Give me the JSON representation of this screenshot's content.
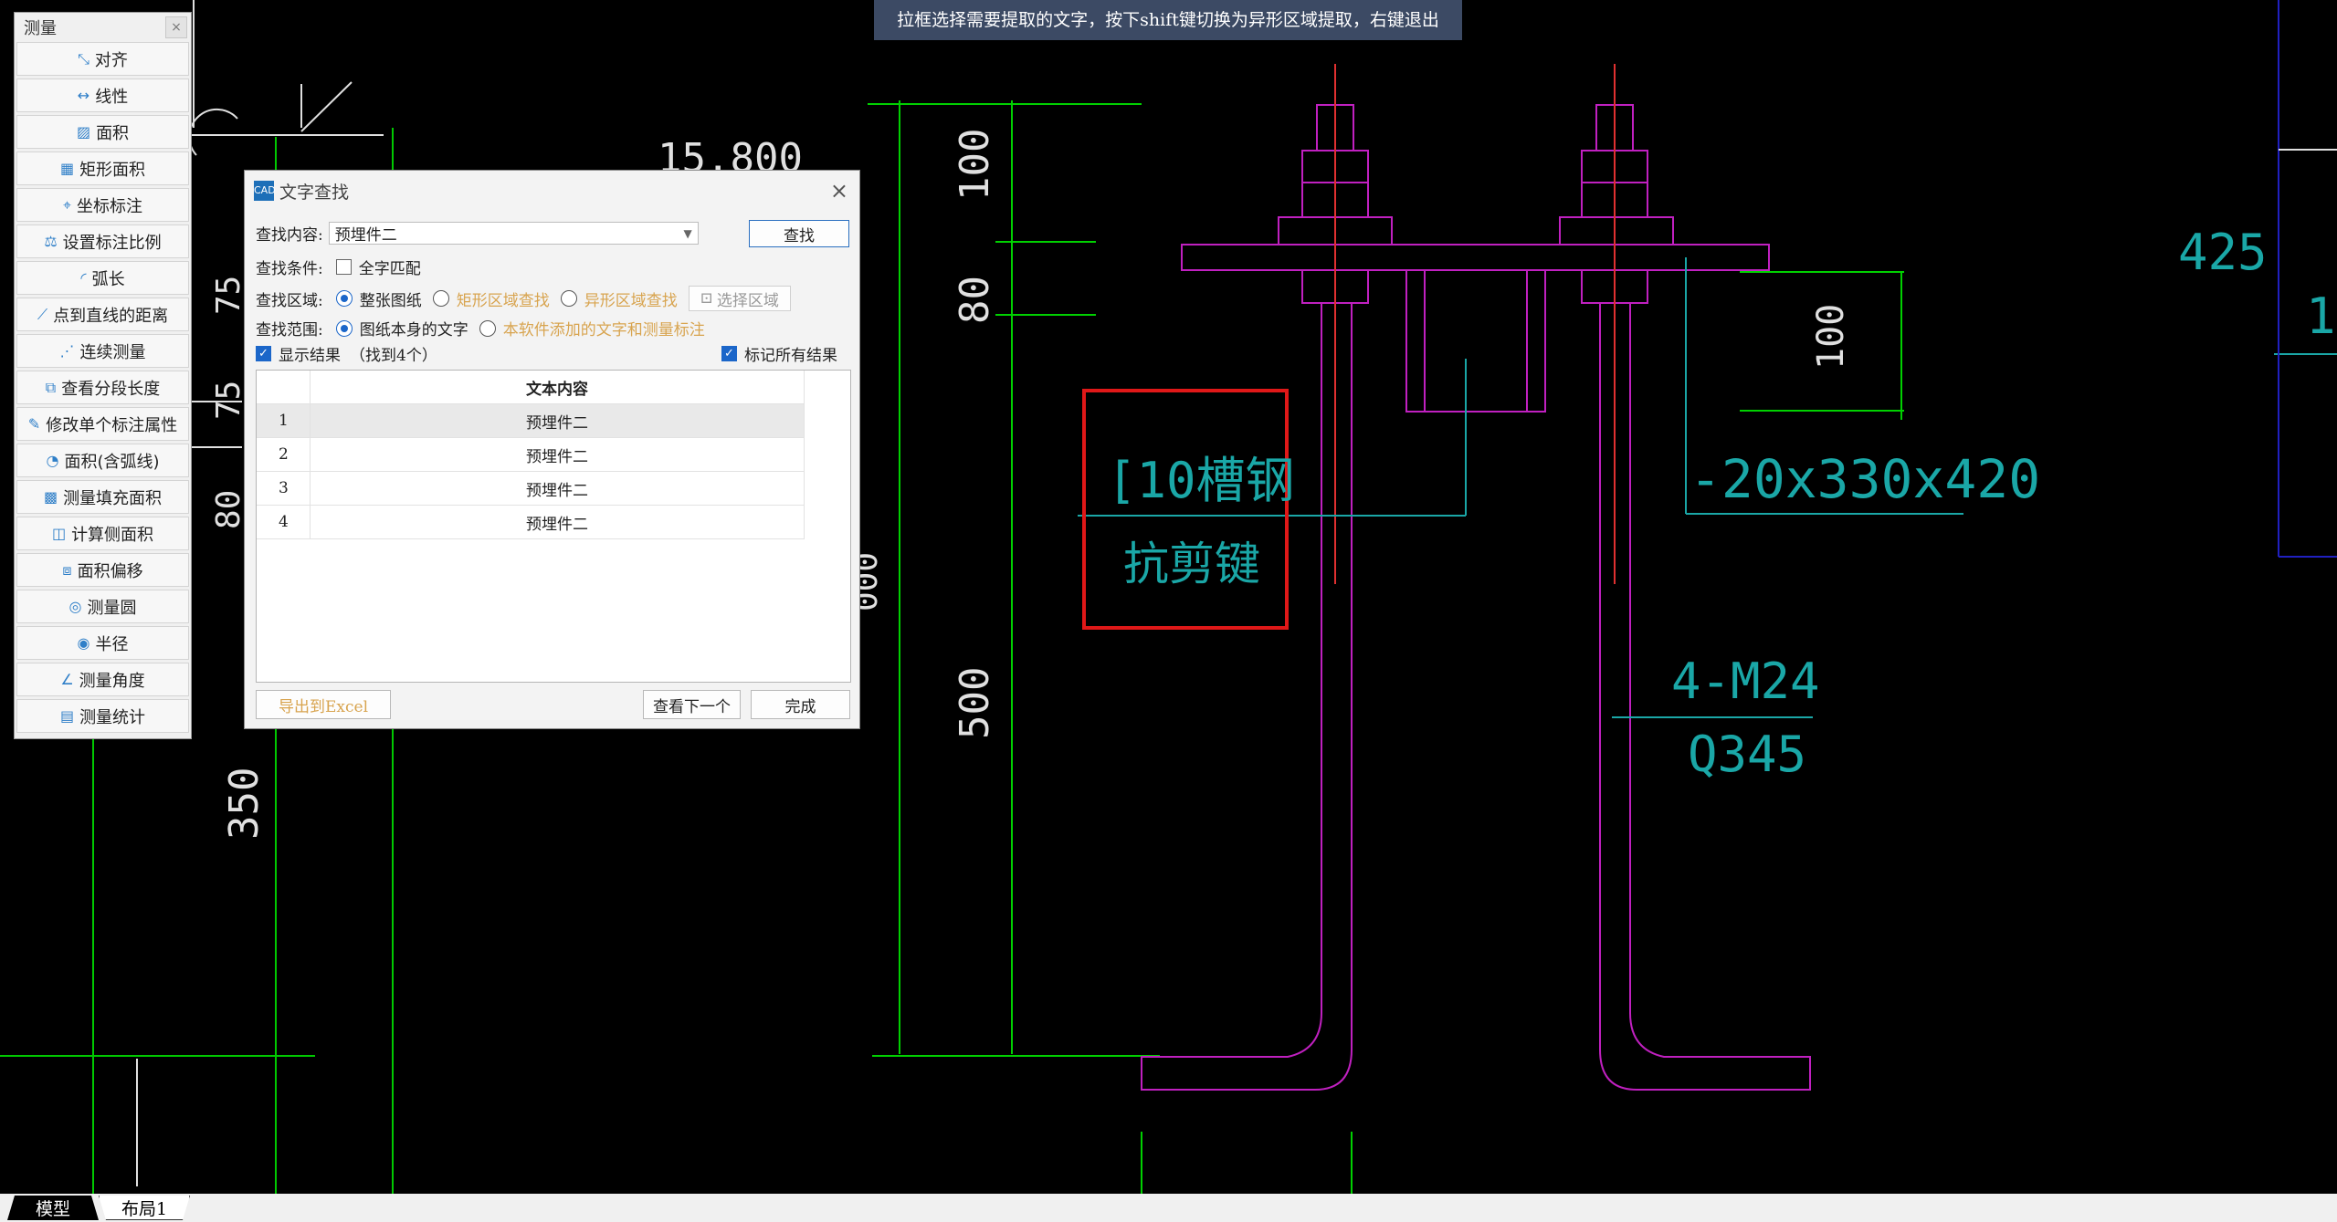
{
  "hint": "拉框选择需要提取的文字，按下shift键切换为异形区域提取，右键退出",
  "palette": {
    "title": "测量",
    "close": "×",
    "items": [
      {
        "label": "对齐",
        "icon": "align-measure-icon",
        "glyph": "⤡"
      },
      {
        "label": "线性",
        "icon": "linear-measure-icon",
        "glyph": "↔"
      },
      {
        "label": "面积",
        "icon": "area-icon",
        "glyph": "▨"
      },
      {
        "label": "矩形面积",
        "icon": "rect-area-icon",
        "glyph": "▦"
      },
      {
        "label": "坐标标注",
        "icon": "coordinate-icon",
        "glyph": "⌖"
      },
      {
        "label": "设置标注比例",
        "icon": "scale-icon",
        "glyph": "⚖"
      },
      {
        "label": "弧长",
        "icon": "arc-length-icon",
        "glyph": "◜"
      },
      {
        "label": "点到直线的距离",
        "icon": "point-line-icon",
        "glyph": "⟋"
      },
      {
        "label": "连续测量",
        "icon": "continuous-measure-icon",
        "glyph": "⋰"
      },
      {
        "label": "查看分段长度",
        "icon": "segment-length-icon",
        "glyph": "⧉"
      },
      {
        "label": "修改单个标注属性",
        "icon": "edit-dimension-icon",
        "glyph": "✎"
      },
      {
        "label": "面积(含弧线)",
        "icon": "arc-area-icon",
        "glyph": "◔"
      },
      {
        "label": "测量填充面积",
        "icon": "fill-area-icon",
        "glyph": "▩"
      },
      {
        "label": "计算侧面积",
        "icon": "side-area-icon",
        "glyph": "◫"
      },
      {
        "label": "面积偏移",
        "icon": "area-offset-icon",
        "glyph": "⧈"
      },
      {
        "label": "测量圆",
        "icon": "circle-measure-icon",
        "glyph": "◎"
      },
      {
        "label": "半径",
        "icon": "radius-icon",
        "glyph": "◉"
      },
      {
        "label": "测量角度",
        "icon": "angle-icon",
        "glyph": "∠"
      },
      {
        "label": "测量统计",
        "icon": "statistics-icon",
        "glyph": "▤"
      }
    ]
  },
  "dialog": {
    "title": "文字查找",
    "app_icon_text": "CAD",
    "close": "×",
    "search_label": "查找内容:",
    "search_value": "预埋件二",
    "find_button": "查找",
    "condition_label": "查找条件:",
    "whole_word": "全字匹配",
    "area_label": "查找区域:",
    "area_options": [
      "整张图纸",
      "矩形区域查找",
      "异形区域查找"
    ],
    "select_area_button": "选择区域",
    "scope_label": "查找范围:",
    "scope_options": [
      "图纸本身的文字",
      "本软件添加的文字和测量标注"
    ],
    "show_results": "显示结果",
    "found_count": "（找到4个）",
    "mark_all": "标记所有结果",
    "table_header": "文本内容",
    "rows": [
      {
        "num": "1",
        "text": "预埋件二"
      },
      {
        "num": "2",
        "text": "预埋件二"
      },
      {
        "num": "3",
        "text": "预埋件二"
      },
      {
        "num": "4",
        "text": "预埋件二"
      }
    ],
    "export_button": "导出到Excel",
    "next_button": "查看下一个",
    "done_button": "完成"
  },
  "drawing": {
    "elevation": "15.800",
    "dims_left": [
      "75",
      "75",
      "80",
      "350"
    ],
    "dims_center": [
      "100",
      "80",
      "500"
    ],
    "dim_plate": "100",
    "dim_partial": "000",
    "label_channel": "[10槽钢",
    "label_shear": "抗剪键",
    "label_plate": "-20x330x420",
    "label_bolt": "4-M24",
    "label_steel": "Q345",
    "label_right1": "425",
    "label_right2": "1."
  },
  "tabs": [
    "模型",
    "布局1"
  ],
  "colors": {
    "background": "#000000",
    "magenta": "#c020c0",
    "green": "#00d000",
    "white_lines": "#e0e0e0",
    "cyan_text": "#1aa7a7",
    "red_box": "#e01818",
    "blue": "#2020c0"
  }
}
